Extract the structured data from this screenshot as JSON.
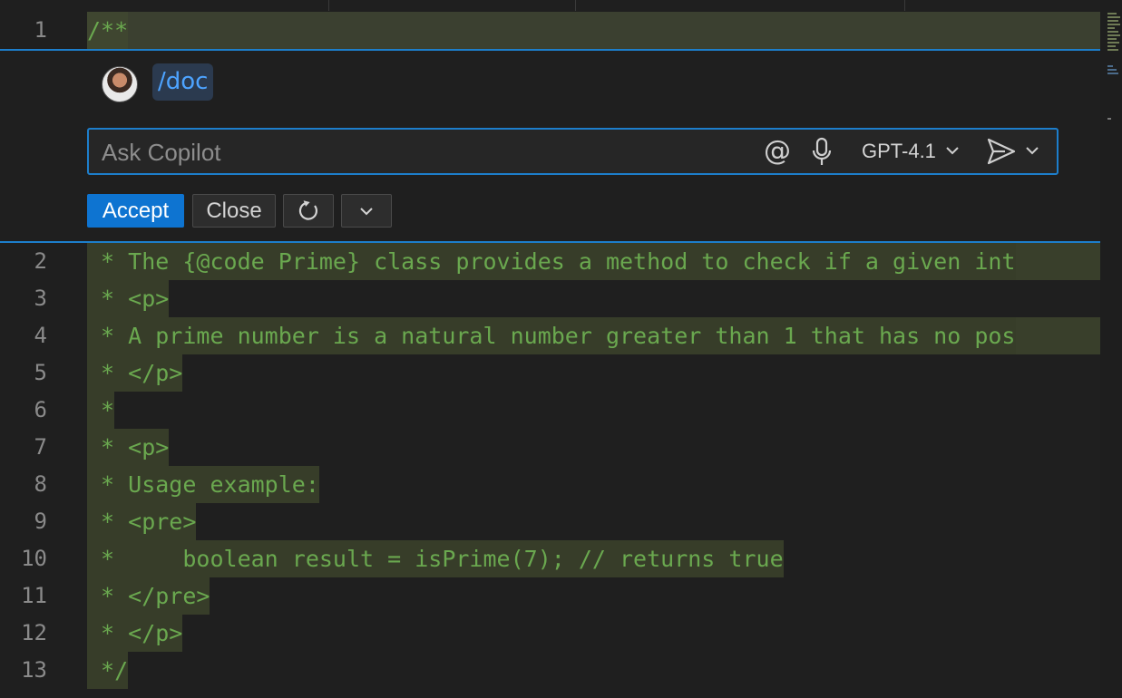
{
  "editor": {
    "first_line": {
      "num": "1",
      "text": "/**"
    },
    "lines": [
      {
        "num": "2",
        "text": " * The {@code Prime} class provides a method to check if a given int"
      },
      {
        "num": "3",
        "text": " * <p>"
      },
      {
        "num": "4",
        "text": " * A prime number is a natural number greater than 1 that has no pos"
      },
      {
        "num": "5",
        "text": " * </p>"
      },
      {
        "num": "6",
        "text": " *"
      },
      {
        "num": "7",
        "text": " * <p>"
      },
      {
        "num": "8",
        "text": " * Usage example:"
      },
      {
        "num": "9",
        "text": " * <pre>"
      },
      {
        "num": "10",
        "text": " *     boolean result = isPrime(7); // returns true"
      },
      {
        "num": "11",
        "text": " * </pre>"
      },
      {
        "num": "12",
        "text": " * </p>"
      },
      {
        "num": "13",
        "text": " */"
      }
    ]
  },
  "chat": {
    "command": "/doc",
    "input_placeholder": "Ask Copilot",
    "input_value": "",
    "mention_symbol": "@",
    "model": "GPT-4.1",
    "icons": {
      "avatar": "user-avatar",
      "mic": "microphone-icon",
      "model_dropdown": "chevron-down-icon",
      "send": "send-icon",
      "send_dropdown": "chevron-down-icon",
      "rerun": "refresh-icon",
      "more": "chevron-down-icon"
    },
    "buttons": {
      "accept": "Accept",
      "close": "Close"
    }
  },
  "colors": {
    "accent": "#0e74d1",
    "focus_border": "#1d7ecb",
    "comment_text": "#6aa84f",
    "diff_highlight": "#393f2b",
    "command_chip": "#2b3a4f",
    "command_text": "#4da3ff"
  }
}
